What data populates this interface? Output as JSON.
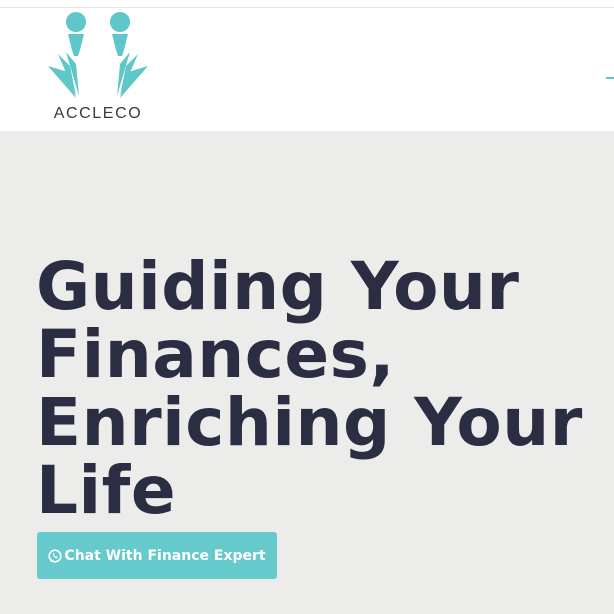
{
  "header": {
    "logo_text": "ACCLECO",
    "accent_color": "#5fc6c9"
  },
  "hero": {
    "headline_lines": [
      "Guiding Your",
      "Finances,",
      "Enriching Your",
      "Life"
    ],
    "cta_label": "Chat With Finance Expert",
    "cta_icon": "whatsapp-icon",
    "text_color": "#2b2d42",
    "background_color": "#ececea",
    "button_color": "#66c9cb"
  }
}
